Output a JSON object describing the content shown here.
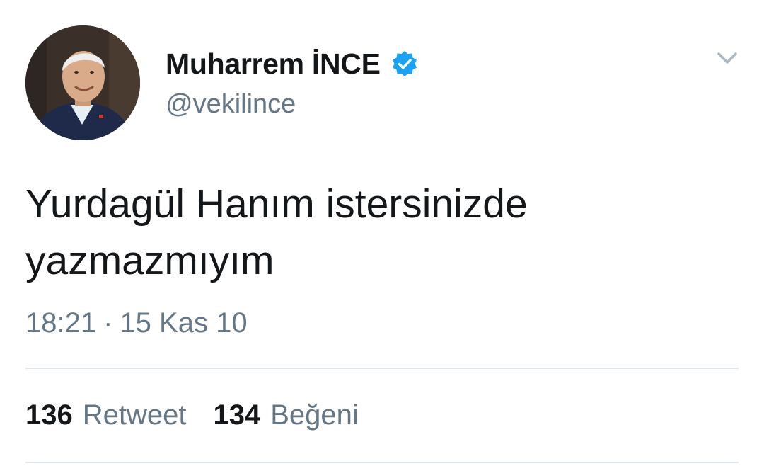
{
  "author": {
    "display_name": "Muharrem İNCE",
    "handle": "@vekilince",
    "avatar": "profile-photo",
    "verified": true,
    "verified_color": "#1da1f2"
  },
  "tweet": {
    "text_line1": "Yurdagül Hanım istersinizde",
    "text_line2": "yazmazmıyım",
    "time": "18:21",
    "separator": "·",
    "date": "15 Kas 10"
  },
  "stats": {
    "retweet_count": "136",
    "retweet_label": "Retweet",
    "like_count": "134",
    "like_label": "Beğeni"
  },
  "icons": {
    "menu": "chevron-down-icon",
    "verified": "verified-badge-icon"
  },
  "colors": {
    "text_primary": "#14171a",
    "text_secondary": "#657786",
    "divider": "#e1e8ed",
    "verified_badge": "#1da1f2"
  }
}
